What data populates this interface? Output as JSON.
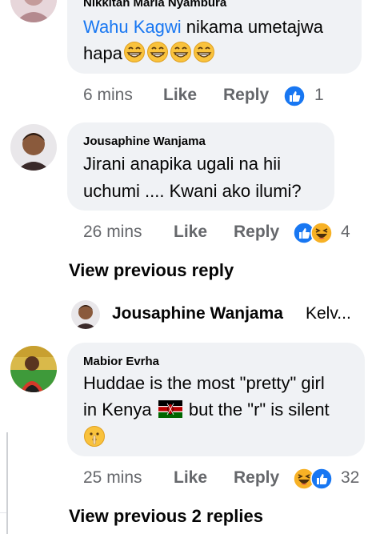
{
  "comments": [
    {
      "author": "Nikkitah Maria Nyambura",
      "mention": "Wahu Kagwi",
      "text_line1": " nikama umetajwa",
      "text_line2": "hapa",
      "time": "6 mins",
      "like_label": "Like",
      "reply_label": "Reply",
      "reaction_count": "1",
      "reactions": [
        "like-reaction-icon"
      ]
    },
    {
      "author": "Jousaphine Wanjama",
      "text_line1": "Jirani anapika ugali na hii",
      "text_line2": "uchumi .... Kwani ako ilumi?",
      "time": "26 mins",
      "like_label": "Like",
      "reply_label": "Reply",
      "reaction_count": "4",
      "reactions": [
        "like-reaction-icon",
        "haha-reaction-icon"
      ]
    },
    {
      "author": "Mabior Evrha",
      "text_line1": "Huddae is the most \"pretty\" girl",
      "text_line2_a": "in Kenya",
      "text_line2_b": " but the \"r\" is silent",
      "time": "25 mins",
      "like_label": "Like",
      "reply_label": "Reply",
      "reaction_count": "32",
      "reactions": [
        "haha-reaction-icon",
        "like-reaction-icon"
      ]
    }
  ],
  "view_previous_reply": "View previous reply",
  "reply_preview": {
    "author": "Jousaphine Wanjama",
    "snippet": "Kelv..."
  },
  "view_previous_replies": "View previous 2 replies",
  "colors": {
    "link": "#1877f2",
    "bubble": "#f0f2f5",
    "meta": "#65676b",
    "reaction_like": "#1877f2",
    "reaction_haha": "#f7b125"
  }
}
